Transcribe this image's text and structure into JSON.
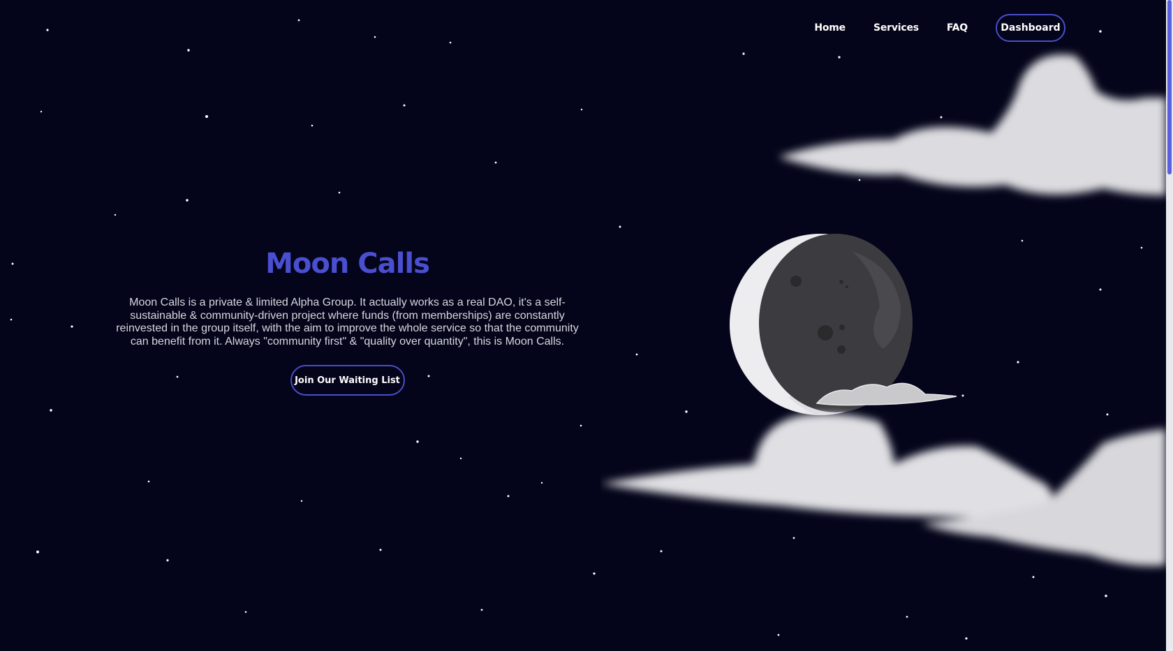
{
  "nav": {
    "links": [
      "Home",
      "Services",
      "FAQ"
    ],
    "dashboard_label": "Dashboard"
  },
  "hero": {
    "title": "Moon Calls",
    "description": "Moon Calls is a private & limited Alpha Group. It actually works as a real DAO, it's a self-sustainable & community-driven project where funds (from memberships) are constantly reinvested in the group itself, with the aim to improve the whole service so that the community can benefit from it. Always \"community first\" & \"quality over quantity\", this is Moon Calls.",
    "cta_label": "Join Our Waiting List"
  },
  "colors": {
    "background": "#04041a",
    "accent": "#4a4ec9",
    "title": "#4a4fd0",
    "text": "#d8d8e0"
  },
  "icons": [
    "moon-illustration",
    "cloud-illustration",
    "star-field"
  ]
}
